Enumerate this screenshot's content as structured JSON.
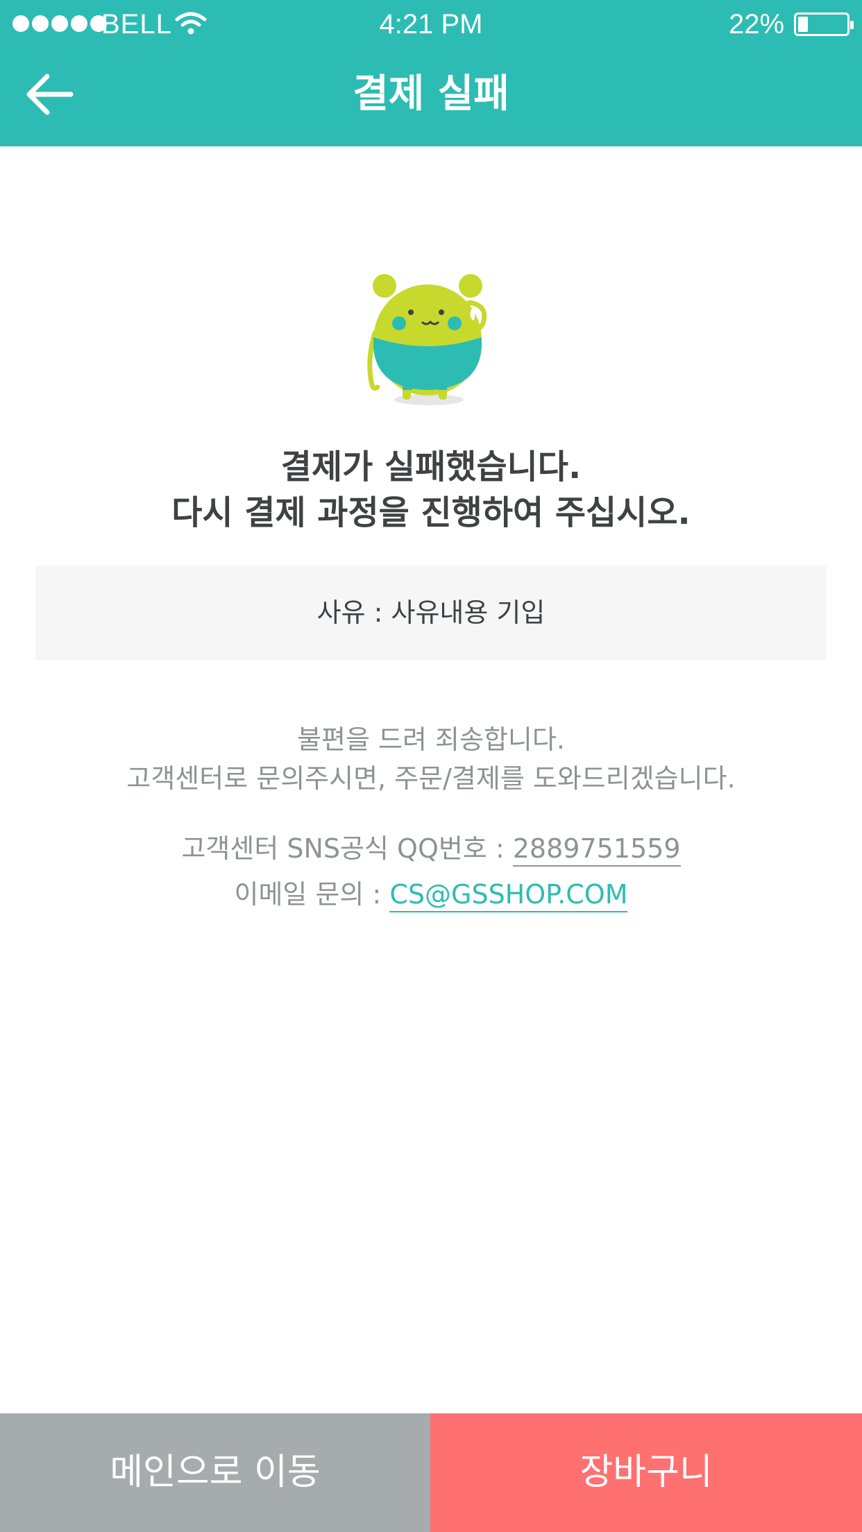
{
  "status_bar": {
    "carrier": "BELL",
    "time": "4:21 PM",
    "battery_percent": "22%",
    "battery_level": 0.22,
    "signal_bars": 5
  },
  "header": {
    "title": "결제 실패",
    "back_icon": "arrow-left-icon"
  },
  "content": {
    "mascot_icon": "bear-mascot-icon",
    "headline_line1": "결제가 실패했습니다.",
    "headline_line2": "다시 결제 과정을 진행하여 주십시오.",
    "reason": "사유 : 사유내용 기입",
    "apology_line1": "불편을 드려 죄송합니다.",
    "apology_line2": "고객센터로 문의주시면, 주문/결제를 도와드리겠습니다.",
    "qq_label": "고객센터 SNS공식 QQ번호 : ",
    "qq_number": "2889751559",
    "email_label": "이메일 문의 : ",
    "email": "CS@GSSHOP.COM"
  },
  "bottom_bar": {
    "main_label": "메인으로 이동",
    "cart_label": "장바구니"
  },
  "colors": {
    "accent": "#2dbcb3",
    "secondary_button": "#a6acae",
    "primary_button": "#ff7070"
  }
}
